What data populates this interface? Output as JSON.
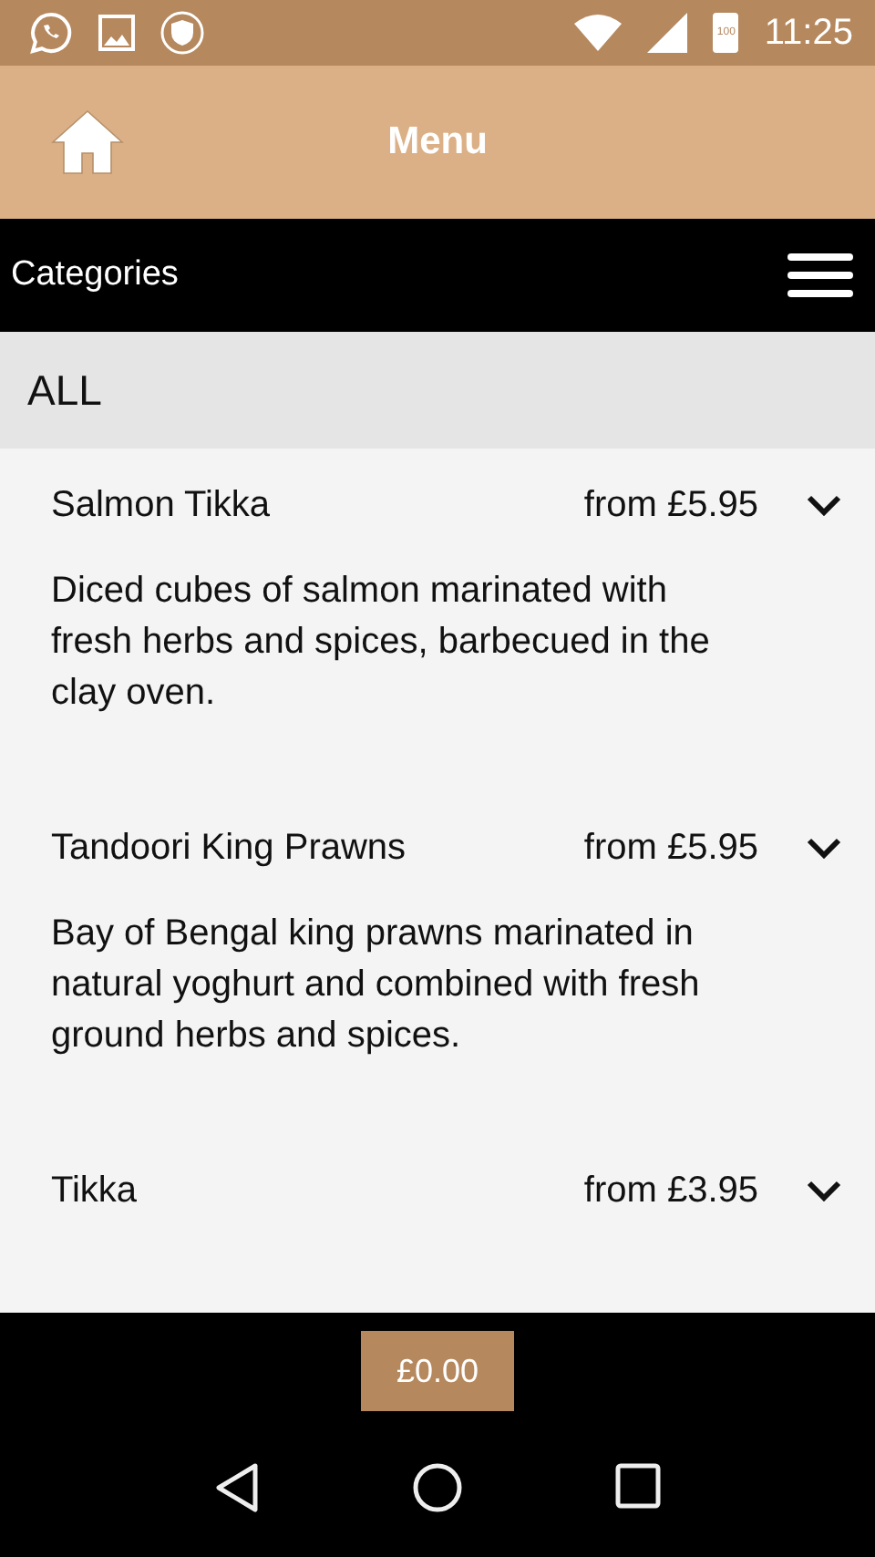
{
  "status_bar": {
    "time": "11:25",
    "battery": "100"
  },
  "header": {
    "title": "Menu"
  },
  "categories_bar": {
    "label": "Categories"
  },
  "category": {
    "title": "ALL"
  },
  "items": [
    {
      "name": "Salmon Tikka",
      "price": "from £5.95",
      "description": "Diced cubes of salmon marinated with fresh herbs and spices, barbecued in the clay oven."
    },
    {
      "name": "Tandoori King Prawns",
      "price": "from £5.95",
      "description": "Bay of Bengal king prawns marinated in natural yoghurt and combined with fresh ground herbs and spices."
    },
    {
      "name": "Tikka",
      "price": "from £3.95"
    }
  ],
  "cart": {
    "total": "£0.00"
  }
}
